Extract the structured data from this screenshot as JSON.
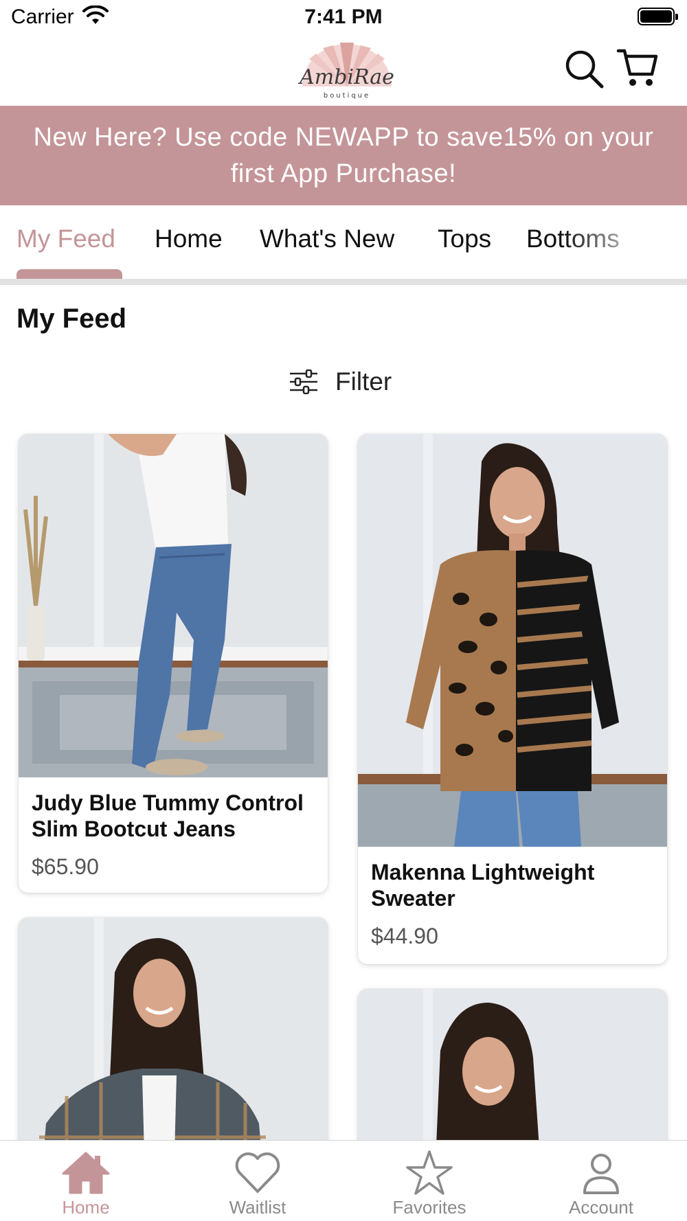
{
  "status_bar": {
    "carrier": "Carrier",
    "time": "7:41 PM"
  },
  "header": {
    "logo_text": "AmbiRae",
    "logo_subtext": "boutique"
  },
  "promo": {
    "text": "New Here? Use code NEWAPP to save15% on your first App Purchase!"
  },
  "tabs": [
    {
      "label": "My Feed",
      "active": true
    },
    {
      "label": "Home",
      "active": false
    },
    {
      "label": "What's New",
      "active": false
    },
    {
      "label": "Tops",
      "active": false
    },
    {
      "label": "Bottoms",
      "active": false
    }
  ],
  "feed": {
    "title": "My Feed",
    "filter_label": "Filter"
  },
  "products": [
    {
      "name": "Judy Blue Tummy Control Slim Bootcut Jeans",
      "price": "$65.90"
    },
    {
      "name": "Makenna Lightweight Sweater",
      "price": "$44.90"
    }
  ],
  "bottom_nav": [
    {
      "label": "Home",
      "icon": "home-icon",
      "active": true
    },
    {
      "label": "Waitlist",
      "icon": "heart-icon",
      "active": false
    },
    {
      "label": "Favorites",
      "icon": "star-icon",
      "active": false
    },
    {
      "label": "Account",
      "icon": "person-icon",
      "active": false
    }
  ],
  "colors": {
    "brand": "#c49598",
    "divider": "#e2e2e2",
    "nav_inactive": "#8a8a8a"
  }
}
